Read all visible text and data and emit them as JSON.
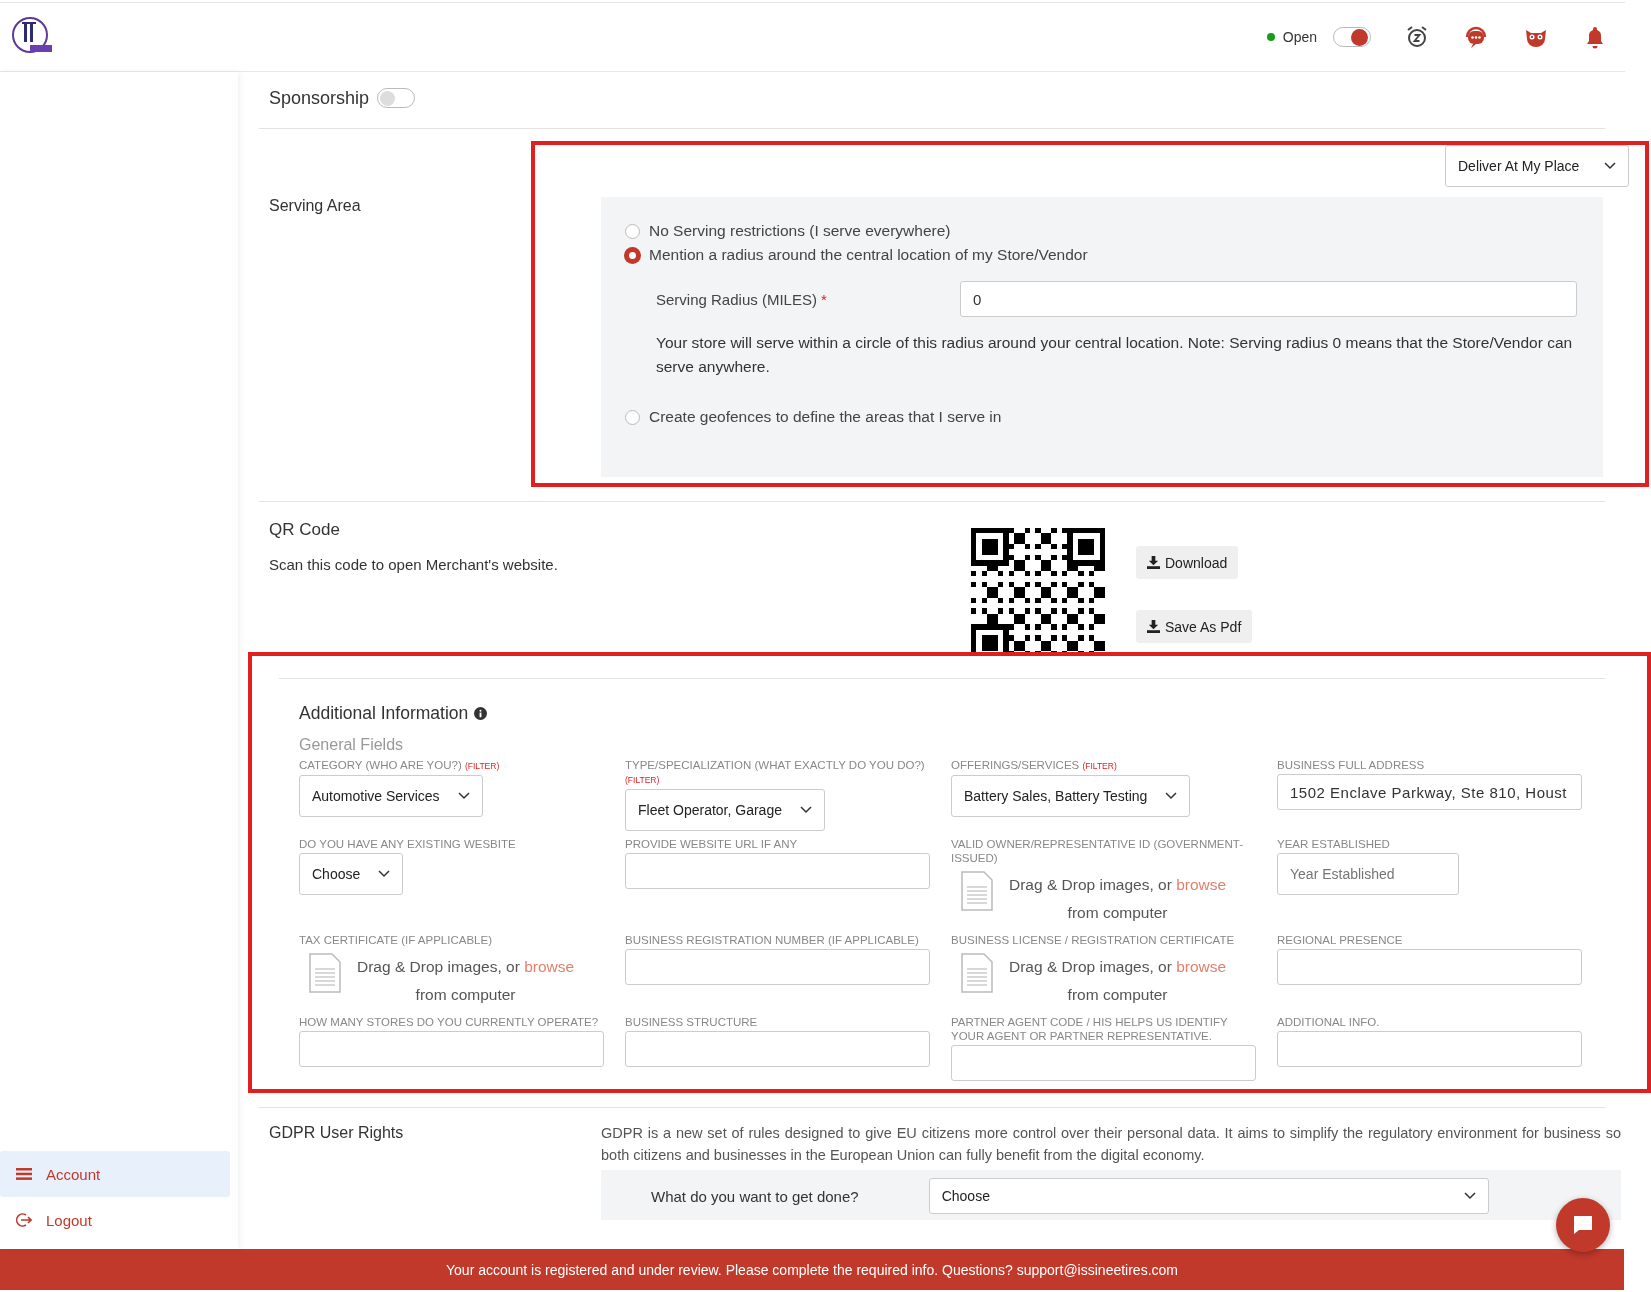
{
  "header": {
    "status": {
      "label": "Open",
      "on": true
    }
  },
  "sidebar": {
    "items": [
      {
        "label": "Account",
        "selected": true
      },
      {
        "label": "Logout",
        "selected": false
      }
    ]
  },
  "sponsorship": {
    "label": "Sponsorship",
    "on": false
  },
  "serving_area": {
    "label": "Serving Area",
    "delivery_select": "Deliver At My Place",
    "options": [
      {
        "label": "No Serving restrictions (I serve everywhere)",
        "selected": false
      },
      {
        "label": "Mention a radius around the central location of my Store/Vendor",
        "selected": true
      },
      {
        "label": "Create geofences to define the areas that I serve in",
        "selected": false
      }
    ],
    "radius_label": "Serving Radius (MILES)",
    "required_mark": "*",
    "radius_value": "0",
    "note": "Your store will serve within a circle of this radius around your central location. Note: Serving radius 0 means that the Store/Vendor can serve anywhere."
  },
  "qr_code": {
    "title": "QR Code",
    "description": "Scan this code to open Merchant's website.",
    "buttons": [
      "Download",
      "Save As Pdf"
    ]
  },
  "additional_information": {
    "title": "Additional Information",
    "subtitle": "General Fields",
    "fields": [
      {
        "kind": "select",
        "label": "CATEGORY (WHO ARE YOU?)",
        "tag": "(FILTER)",
        "value": "Automotive Services"
      },
      {
        "kind": "select",
        "label": "TYPE/SPECIALIZATION (WHAT EXACTLY DO YOU DO?)",
        "tag": "(FILTER)",
        "value": "Fleet Operator, Garage"
      },
      {
        "kind": "select",
        "label": "OFFERINGS/SERVICES",
        "tag": "(FILTER)",
        "value": "Battery Sales, Battery Testing"
      },
      {
        "kind": "input",
        "label": "BUSINESS FULL ADDRESS",
        "value": "1502 Enclave Parkway, Ste 810, Houst"
      },
      {
        "kind": "select",
        "label": "DO YOU HAVE ANY EXISTING WESBITE",
        "value": "Choose"
      },
      {
        "kind": "input",
        "label": "PROVIDE WEBSITE URL IF ANY"
      },
      {
        "kind": "upload",
        "label": "VALID OWNER/REPRESENTATIVE ID (GOVERNMENT-ISSUED)",
        "drop_text": "Drag & Drop images, or",
        "browse": "browse",
        "drop_subtext": "from computer"
      },
      {
        "kind": "input",
        "label": "YEAR ESTABLISHED",
        "placeholder": "Year Established",
        "narrow": true
      },
      {
        "kind": "upload",
        "label": "TAX CERTIFICATE (IF APPLICABLE)",
        "drop_text": "Drag & Drop images, or",
        "browse": "browse",
        "drop_subtext": "from computer"
      },
      {
        "kind": "input",
        "label": "BUSINESS REGISTRATION NUMBER (IF APPLICABLE)"
      },
      {
        "kind": "upload",
        "label": "BUSINESS LICENSE / REGISTRATION CERTIFICATE",
        "drop_text": "Drag & Drop images, or",
        "browse": "browse",
        "drop_subtext": "from computer"
      },
      {
        "kind": "input",
        "label": "REGIONAL PRESENCE"
      },
      {
        "kind": "input",
        "label": "HOW MANY STORES DO YOU CURRENTLY OPERATE?"
      },
      {
        "kind": "input",
        "label": "BUSINESS STRUCTURE"
      },
      {
        "kind": "input",
        "label": "PARTNER AGENT CODE / HIS HELPS US IDENTIFY YOUR AGENT OR PARTNER REPRESENTATIVE."
      },
      {
        "kind": "input",
        "label": "ADDITIONAL INFO."
      }
    ]
  },
  "gdpr": {
    "title": "GDPR User Rights",
    "text": "GDPR is a new set of rules designed to give EU citizens more control over their personal data. It aims to simplify the regulatory environment for business so both citizens and businesses in the European Union can fully benefit from the digital economy.",
    "question": "What do you want to get done?",
    "select": "Choose"
  },
  "banner": "Your account is registered and under review. Please complete the required info. Questions? support@issineetires.com"
}
